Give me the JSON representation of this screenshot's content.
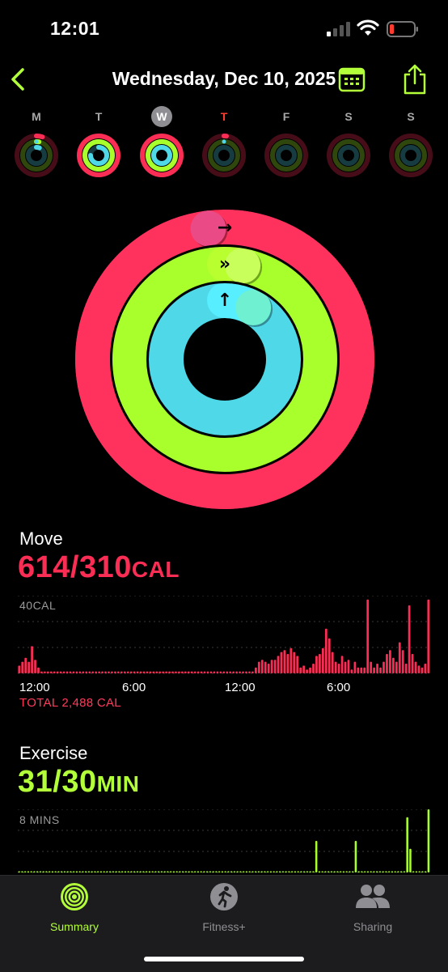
{
  "status_bar": {
    "time": "12:01"
  },
  "nav": {
    "title": "Wednesday, Dec 10, 2025",
    "back_icon": "chevron-left-icon",
    "calendar_icon": "calendar-icon",
    "share_icon": "share-icon"
  },
  "colors": {
    "move": "#fa2d55",
    "exercise": "#a8ff2c",
    "stand": "#4fd8e8",
    "accent": "#b3ff3a"
  },
  "week": [
    {
      "letter": "M",
      "move": 0.05,
      "exercise": 0.03,
      "stand": 0.06,
      "today": false,
      "selected": false
    },
    {
      "letter": "T",
      "move": 1.0,
      "exercise": 1.0,
      "stand": 0.75,
      "today": false,
      "selected": false
    },
    {
      "letter": "W",
      "move": 1.0,
      "exercise": 1.0,
      "stand": 1.0,
      "today": false,
      "selected": true
    },
    {
      "letter": "T",
      "move": 0.02,
      "exercise": 0.0,
      "stand": 0.0,
      "today": true,
      "selected": false
    },
    {
      "letter": "F",
      "move": 0,
      "exercise": 0,
      "stand": 0,
      "today": false,
      "selected": false
    },
    {
      "letter": "S",
      "move": 0,
      "exercise": 0,
      "stand": 0,
      "today": false,
      "selected": false
    },
    {
      "letter": "S",
      "move": 0,
      "exercise": 0,
      "stand": 0,
      "today": false,
      "selected": false
    }
  ],
  "rings": {
    "move_progress": 1.98,
    "exercise_progress": 1.03,
    "stand_progress": 1.08
  },
  "move": {
    "label": "Move",
    "value": "614/310",
    "unit": "CAL",
    "axis_max_label": "40CAL",
    "ticks": [
      "12:00",
      "6:00",
      "12:00",
      "6:00"
    ],
    "total": "TOTAL 2,488 CAL"
  },
  "exercise": {
    "label": "Exercise",
    "value": "31/30",
    "unit": "MIN",
    "axis_max_label": "8 MINS"
  },
  "tabs": [
    {
      "label": "Summary",
      "icon": "summary-rings-icon",
      "active": true
    },
    {
      "label": "Fitness+",
      "icon": "fitness-plus-icon",
      "active": false
    },
    {
      "label": "Sharing",
      "icon": "sharing-people-icon",
      "active": false
    }
  ],
  "chart_data": [
    {
      "type": "bar",
      "title": "Move",
      "ylabel": "CAL",
      "ylim": [
        0,
        40
      ],
      "x_ticks": [
        "12:00",
        "6:00",
        "12:00",
        "6:00"
      ],
      "values": [
        4,
        6,
        8,
        6,
        14,
        7,
        3,
        1,
        1,
        1,
        1,
        1,
        1,
        1,
        1,
        1,
        1,
        1,
        1,
        1,
        1,
        1,
        1,
        1,
        1,
        1,
        1,
        1,
        1,
        1,
        1,
        1,
        1,
        1,
        1,
        1,
        1,
        1,
        1,
        1,
        1,
        1,
        1,
        1,
        1,
        1,
        1,
        1,
        1,
        1,
        1,
        1,
        1,
        1,
        1,
        1,
        1,
        1,
        1,
        1,
        1,
        1,
        1,
        1,
        1,
        1,
        1,
        1,
        1,
        1,
        1,
        1,
        1,
        1,
        3,
        6,
        7,
        6,
        5,
        7,
        7,
        9,
        11,
        12,
        10,
        13,
        11,
        9,
        3,
        4,
        2,
        3,
        5,
        9,
        10,
        13,
        23,
        18,
        11,
        6,
        5,
        9,
        6,
        7,
        2,
        6,
        3,
        3,
        3,
        38,
        6,
        3,
        5,
        3,
        6,
        10,
        12,
        8,
        6,
        16,
        12,
        5,
        35,
        10,
        6,
        4,
        3,
        5,
        38
      ]
    },
    {
      "type": "bar",
      "title": "Exercise",
      "ylabel": "MINS",
      "ylim": [
        0,
        8
      ],
      "values": [
        0,
        0,
        0,
        0,
        0,
        0,
        0,
        0,
        0,
        0,
        0,
        0,
        0,
        0,
        0,
        0,
        0,
        0,
        0,
        0,
        0,
        0,
        0,
        0,
        0,
        0,
        0,
        0,
        0,
        0,
        0,
        0,
        0,
        0,
        0,
        0,
        0,
        0,
        0,
        0,
        0,
        0,
        0,
        0,
        0,
        0,
        0,
        0,
        0,
        0,
        0,
        0,
        0,
        0,
        0,
        0,
        0,
        0,
        0,
        0,
        0,
        0,
        0,
        0,
        0,
        0,
        0,
        0,
        0,
        0,
        0,
        0,
        0,
        0,
        0,
        0,
        0,
        0,
        0,
        0,
        0,
        0,
        0,
        0,
        0,
        0,
        0,
        0,
        0,
        0,
        0,
        0,
        0,
        0,
        0,
        0,
        0,
        0,
        4,
        0,
        0,
        0,
        0,
        0,
        0,
        0,
        0,
        0,
        0,
        0,
        0,
        4,
        0,
        0,
        0,
        0,
        0,
        0,
        0,
        0,
        0,
        0,
        0,
        0,
        0,
        0,
        0,
        0,
        7,
        3,
        0,
        0,
        0,
        0,
        0,
        8
      ]
    }
  ]
}
